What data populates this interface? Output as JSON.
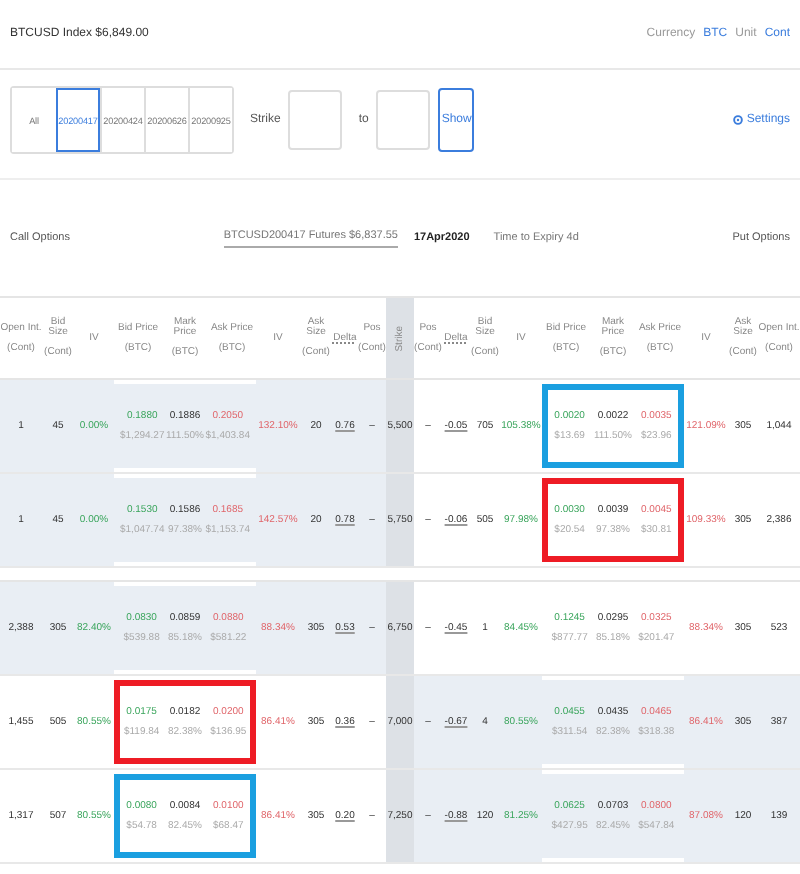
{
  "header": {
    "title": "BTCUSD Index $6,849.00",
    "currency_label": "Currency",
    "currency": "BTC",
    "unit_label": "Unit",
    "unit": "Cont"
  },
  "filters": {
    "expiries": [
      {
        "label": "All",
        "selected": false
      },
      {
        "label": "20200417",
        "selected": true
      },
      {
        "label": "20200424",
        "selected": false
      },
      {
        "label": "20200626",
        "selected": false
      },
      {
        "label": "20200925",
        "selected": false
      }
    ],
    "strike_label": "Strike",
    "to_label": "to",
    "show_button": "Show",
    "settings": "Settings"
  },
  "section": {
    "calls_title": "Call Options",
    "futures": "BTCUSD200417 Futures $6,837.55",
    "expiry_date": "17Apr2020",
    "time_to_expiry": "Time to Expiry 4d",
    "puts_title": "Put Options"
  },
  "columns": [
    {
      "name": "Open Int.",
      "unit": "(Cont)"
    },
    {
      "name": "Bid Size",
      "unit": "(Cont)"
    },
    {
      "name": "IV"
    },
    {
      "name": "Bid Price",
      "unit": "(BTC)"
    },
    {
      "name": "Mark Price",
      "unit": "(BTC)"
    },
    {
      "name": "Ask Price",
      "unit": "(BTC)"
    },
    {
      "name": "IV"
    },
    {
      "name": "Ask Size",
      "unit": "(Cont)"
    },
    {
      "name": "Delta"
    },
    {
      "name": "Pos",
      "unit": "(Cont)"
    },
    {
      "name": "Strike"
    },
    {
      "name": "Pos",
      "unit": "(Cont)"
    },
    {
      "name": "Delta"
    },
    {
      "name": "Bid Size",
      "unit": "(Cont)"
    },
    {
      "name": "IV"
    },
    {
      "name": "Bid Price",
      "unit": "(BTC)"
    },
    {
      "name": "Mark Price",
      "unit": "(BTC)"
    },
    {
      "name": "Ask Price",
      "unit": "(BTC)"
    },
    {
      "name": "IV"
    },
    {
      "name": "Ask Size",
      "unit": "(Cont)"
    },
    {
      "name": "Open Int.",
      "unit": "(Cont)"
    }
  ],
  "rows": [
    {
      "strike": "5,500",
      "call": {
        "itm": true,
        "open_int": "1",
        "bid_size": "45",
        "bid_iv": "0.00%",
        "bid_price": "0.1880",
        "bid_usd": "$1,294.27",
        "mark_price": "0.1886",
        "mark_iv": "111.50%",
        "ask_price": "0.2050",
        "ask_usd": "$1,403.84",
        "ask_iv": "132.10%",
        "ask_size": "20",
        "delta": "0.76",
        "pos": "–"
      },
      "put": {
        "itm": false,
        "color": "#1a9fe0",
        "pos": "–",
        "delta": "-0.05",
        "bid_size": "705",
        "bid_iv": "105.38%",
        "bid_price": "0.0020",
        "bid_usd": "$13.69",
        "mark_price": "0.0022",
        "mark_iv": "111.50%",
        "ask_price": "0.0035",
        "ask_usd": "$23.96",
        "ask_iv": "121.09%",
        "ask_size": "305",
        "open_int": "1,044"
      }
    },
    {
      "strike": "5,750",
      "call": {
        "itm": true,
        "open_int": "1",
        "bid_size": "45",
        "bid_iv": "0.00%",
        "bid_price": "0.1530",
        "bid_usd": "$1,047.74",
        "mark_price": "0.1586",
        "mark_iv": "97.38%",
        "ask_price": "0.1685",
        "ask_usd": "$1,153.74",
        "ask_iv": "142.57%",
        "ask_size": "20",
        "delta": "0.78",
        "pos": "–"
      },
      "put": {
        "itm": false,
        "color": "#ee1c25",
        "pos": "–",
        "delta": "-0.06",
        "bid_size": "505",
        "bid_iv": "97.98%",
        "bid_price": "0.0030",
        "bid_usd": "$20.54",
        "mark_price": "0.0039",
        "mark_iv": "97.38%",
        "ask_price": "0.0045",
        "ask_usd": "$30.81",
        "ask_iv": "109.33%",
        "ask_size": "305",
        "open_int": "2,386"
      }
    },
    {
      "strike": "6,750",
      "call": {
        "itm": true,
        "open_int": "2,388",
        "bid_size": "305",
        "bid_iv": "82.40%",
        "bid_price": "0.0830",
        "bid_usd": "$539.88",
        "mark_price": "0.0859",
        "mark_iv": "85.18%",
        "ask_price": "0.0880",
        "ask_usd": "$581.22",
        "ask_iv": "88.34%",
        "ask_size": "305",
        "delta": "0.53",
        "pos": "–"
      },
      "put": {
        "itm": false,
        "pos": "–",
        "delta": "-0.45",
        "bid_size": "1",
        "bid_iv": "84.45%",
        "bid_price": "0.1245",
        "bid_usd": "$877.77",
        "mark_price": "0.0295",
        "mark_iv": "85.18%",
        "ask_price": "0.0325",
        "ask_usd": "$201.47",
        "ask_iv": "88.34%",
        "ask_size": "305",
        "open_int": "523"
      }
    },
    {
      "strike": "7,000",
      "call": {
        "itm": false,
        "color": "#ee1c25",
        "open_int": "1,455",
        "bid_size": "505",
        "bid_iv": "80.55%",
        "bid_price": "0.0175",
        "bid_usd": "$119.84",
        "mark_price": "0.0182",
        "mark_iv": "82.38%",
        "ask_price": "0.0200",
        "ask_usd": "$136.95",
        "ask_iv": "86.41%",
        "ask_size": "305",
        "delta": "0.36",
        "pos": "–"
      },
      "put": {
        "itm": true,
        "pos": "–",
        "delta": "-0.67",
        "bid_size": "4",
        "bid_iv": "80.55%",
        "bid_price": "0.0455",
        "bid_usd": "$311.54",
        "mark_price": "0.0435",
        "mark_iv": "82.38%",
        "ask_price": "0.0465",
        "ask_usd": "$318.38",
        "ask_iv": "86.41%",
        "ask_size": "305",
        "open_int": "387"
      }
    },
    {
      "strike": "7,250",
      "call": {
        "itm": false,
        "color": "#1a9fe0",
        "open_int": "1,317",
        "bid_size": "507",
        "bid_iv": "80.55%",
        "bid_price": "0.0080",
        "bid_usd": "$54.78",
        "mark_price": "0.0084",
        "mark_iv": "82.45%",
        "ask_price": "0.0100",
        "ask_usd": "$68.47",
        "ask_iv": "86.41%",
        "ask_size": "305",
        "delta": "0.20",
        "pos": "–"
      },
      "put": {
        "itm": true,
        "pos": "–",
        "delta": "-0.88",
        "bid_size": "120",
        "bid_iv": "81.25%",
        "bid_price": "0.0625",
        "bid_usd": "$427.95",
        "mark_price": "0.0703",
        "mark_iv": "82.45%",
        "ask_price": "0.0800",
        "ask_usd": "$547.84",
        "ask_iv": "87.08%",
        "ask_size": "120",
        "open_int": "139"
      }
    }
  ]
}
